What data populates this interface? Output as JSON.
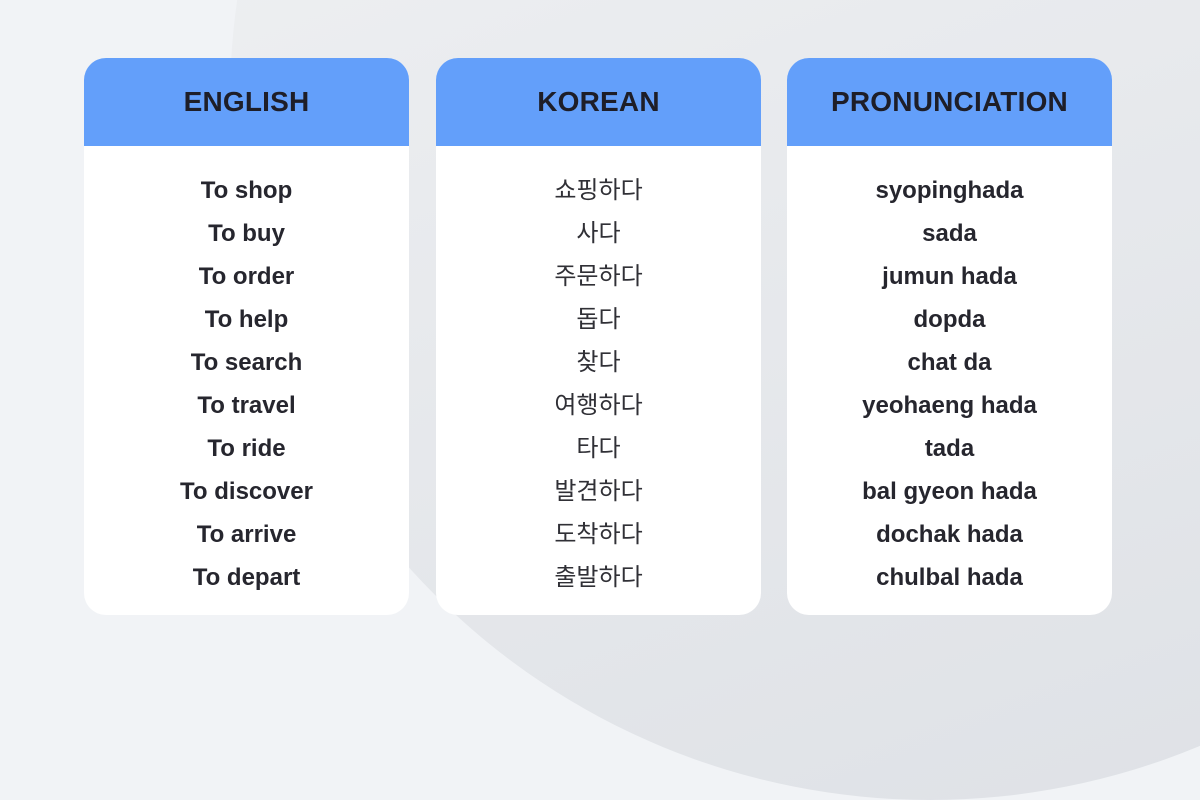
{
  "columns": [
    {
      "header": "ENGLISH",
      "rows": [
        "To shop",
        "To buy",
        "To order",
        "To help",
        "To search",
        "To travel",
        "To ride",
        "To discover",
        "To arrive",
        "To depart"
      ]
    },
    {
      "header": "KOREAN",
      "rows": [
        "쇼핑하다",
        "사다",
        "주문하다",
        "돕다",
        "찾다",
        "여행하다",
        "타다",
        "발견하다",
        "도착하다",
        "출발하다"
      ]
    },
    {
      "header": "PRONUNCIATION",
      "rows": [
        "syopinghada",
        "sada",
        "jumun hada",
        "dopda",
        "chat da",
        "yeohaeng hada",
        "tada",
        "bal gyeon hada",
        "dochak hada",
        "chulbal hada"
      ]
    }
  ],
  "colors": {
    "header_bg": "#639ffa",
    "header_text": "#1e1e28",
    "card_bg": "#ffffff",
    "page_bg": "#f1f3f6"
  }
}
